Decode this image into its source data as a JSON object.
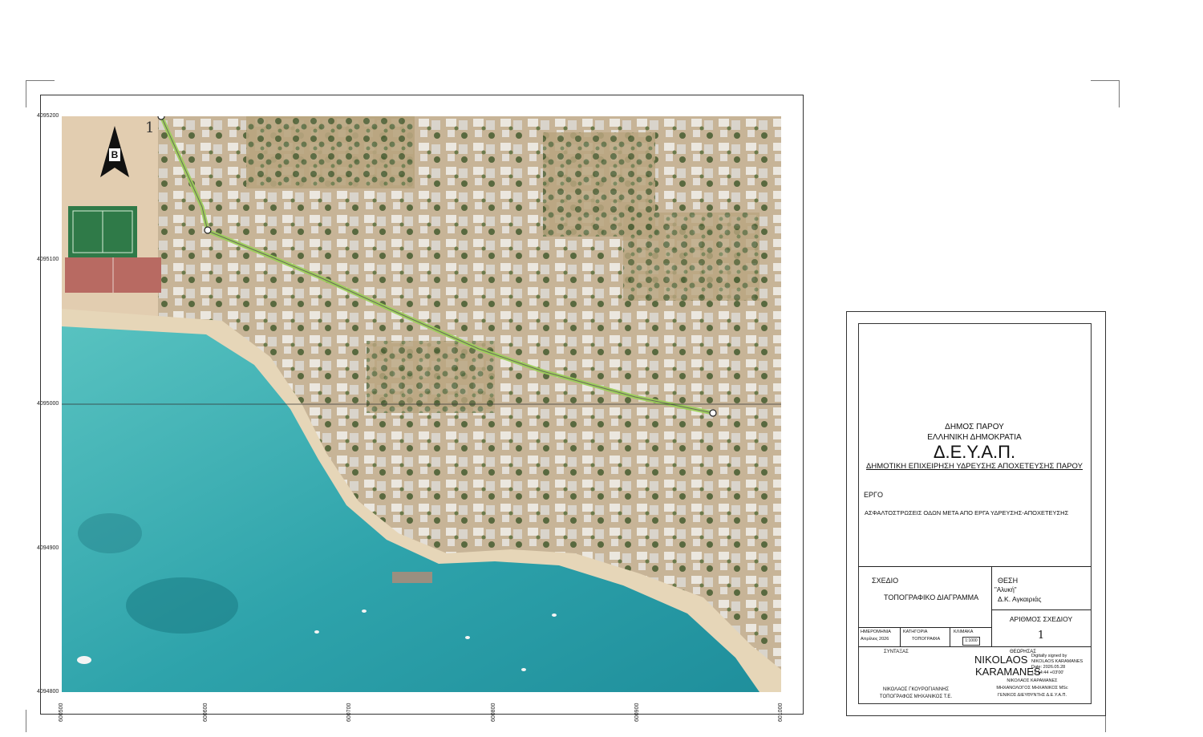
{
  "map": {
    "sheet_number_label": "1",
    "north_arrow_letter": "B",
    "y_ticks": [
      "4095200",
      "4095100",
      "4095000",
      "4094900",
      "4094800"
    ],
    "x_ticks": [
      "600500",
      "600600",
      "600700",
      "600800",
      "600900",
      "601000"
    ],
    "colors": {
      "sea_deep": "#1f8f9c",
      "sea_shallow": "#5cc7c4",
      "land": "#c9b89c",
      "vegetation": "#5d6f45",
      "road_route": "#9ccf5a",
      "buildings": "#e8e4dc"
    }
  },
  "title_block": {
    "org_line1": "ΔΗΜΟΣ ΠΑΡΟΥ",
    "org_line2": "ΕΛΛΗΝΙΚΗ ΔΗΜΟΚΡΑΤΙΑ",
    "org_acronym": "Δ.Ε.Υ.Α.Π.",
    "org_full": "ΔΗΜΟΤΙΚΗ ΕΠΙΧΕΙΡΗΣΗ ΥΔΡΕΥΣΗΣ ΑΠΟΧΕΤΕΥΣΗΣ ΠΑΡΟΥ",
    "project_label": "ΕΡΓΟ",
    "project_name": "ΑΣΦΑΛΤΟΣΤΡΩΣΕΙΣ ΟΔΩΝ ΜΕΤΑ ΑΠΟ ΕΡΓΑ ΥΔΡΕΥΣΗΣ-ΑΠΟΧΕΤΕΥΣΗΣ",
    "drawing_label": "ΣΧΕΔΙΟ",
    "drawing_name": "ΤΟΠΟΓΡΑΦΙΚΟ ΔΙΑΓΡΑΜΜΑ",
    "location_label": "ΘΕΣΗ",
    "location_value": "\"Αλυκή\"",
    "location_district": "Δ.Κ. Αγκαιριάς",
    "date_label": "ΗΜΕΡΟΜΗΝΙΑ",
    "date_value": "Απρίλιος 2026",
    "category_label": "ΚΑΤΗΓΟΡΙΑ",
    "category_value": "ΤΟΠΟΓΡΑΦΙΑ",
    "scale_label": "ΚΛΙΜΑΚΑ",
    "scale_value": "1:1000",
    "drawing_number_label": "ΑΡΙΘΜΟΣ ΣΧΕΔΙΟΥ",
    "drawing_number_value": "1",
    "author_label": "ΣΥΝΤΑΞΑΣ",
    "author_name": "ΝΙΚΟΛΑΟΣ ΓΚΟΥΡΟΓΙΑΝΝΗΣ",
    "author_title": "ΤΟΠΟΓΡΑΦΟΣ ΜΗΧΑΝΙΚΟΣ Τ.Ε.",
    "approved_label": "ΘΕΩΡΗΣΑΣ",
    "signature_name_line1": "NIKOLAOS",
    "signature_name_line2": "KARAMANES",
    "signature_note1": "Digitally signed by",
    "signature_note2": "NIKOLAOS KARAMANES",
    "signature_note3": "Date: 2026.05.28",
    "signature_note4": "13:14:44 +03'00'",
    "approver_name": "ΝΙΚΟΛΑΟΣ ΚΑΡΑΜΑΝΕΣ",
    "approver_title1": "ΜΗΧΑΝΟΛΟΓΟΣ ΜΗΧΑΝΙΚΟΣ MSc",
    "approver_title2": "ΓΕΝΙΚΟΣ ΔΙΕΥΘΥΝΤΗΣ Δ.Ε.Υ.Α.Π."
  }
}
